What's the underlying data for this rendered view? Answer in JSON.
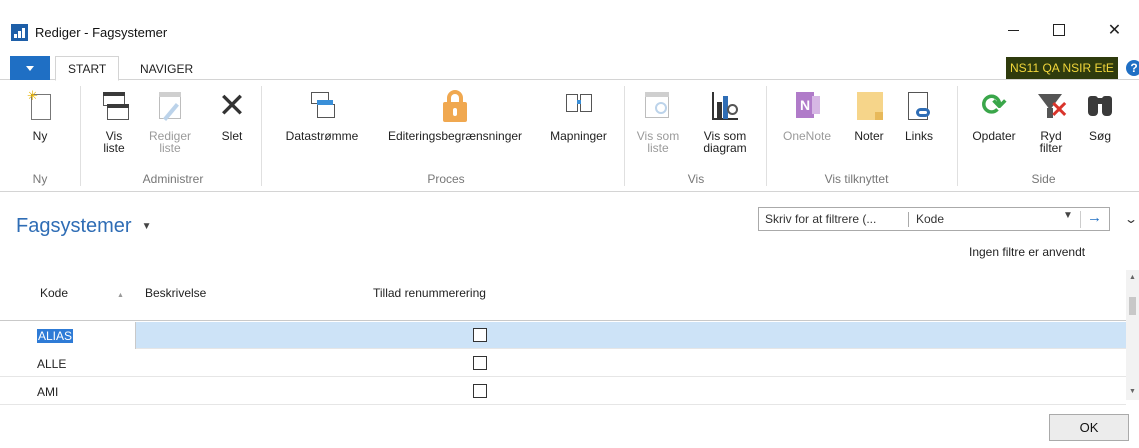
{
  "window": {
    "title": "Rediger - Fagsystemer"
  },
  "tabs": {
    "start": "START",
    "navigate": "NAVIGER"
  },
  "company": "NS11 QA NSIR EtE",
  "ribbon": {
    "ny": "Ny",
    "vis_liste": [
      "Vis",
      "liste"
    ],
    "rediger_liste": [
      "Rediger",
      "liste"
    ],
    "slet": "Slet",
    "datastromme": "Datastrømme",
    "editering": "Editeringsbegrænsninger",
    "mapninger": "Mapninger",
    "vis_som_liste": [
      "Vis som",
      "liste"
    ],
    "vis_som_diagram": [
      "Vis som",
      "diagram"
    ],
    "onenote": "OneNote",
    "noter": "Noter",
    "links": "Links",
    "opdater": "Opdater",
    "ryd_filter": [
      "Ryd",
      "filter"
    ],
    "sog": "Søg",
    "groups": {
      "ny": "Ny",
      "administrer": "Administrer",
      "proces": "Proces",
      "vis": "Vis",
      "vis_tilknyttet": "Vis tilknyttet",
      "side": "Side"
    }
  },
  "page": {
    "title": "Fagsystemer",
    "filter_placeholder": "Skriv for at filtrere (...",
    "filter_field": "Kode",
    "no_filters": "Ingen filtre er anvendt"
  },
  "grid": {
    "columns": {
      "kode": "Kode",
      "beskrivelse": "Beskrivelse",
      "tillad": "Tillad renummerering"
    },
    "rows": [
      {
        "kode": "ALIAS",
        "beskrivelse": "",
        "tillad": false
      },
      {
        "kode": "ALLE",
        "beskrivelse": "",
        "tillad": false
      },
      {
        "kode": "AMI",
        "beskrivelse": "",
        "tillad": false
      }
    ]
  },
  "footer": {
    "ok": "OK"
  },
  "colors": {
    "accent": "#1f6fc4",
    "selection": "#cde3f7",
    "title": "#2f6db5",
    "badge_bg": "#2f3b0d",
    "badge_fg": "#f2d63b"
  }
}
